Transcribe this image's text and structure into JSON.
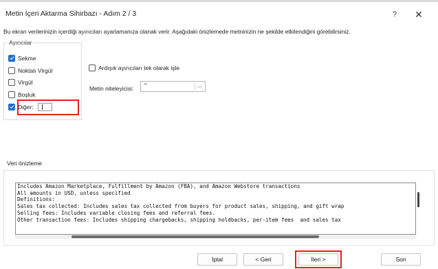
{
  "window": {
    "title": "Metin İçeri Aktarma Sihirbazı - Adım 2 / 3",
    "help_label": "?",
    "close_label": "✕"
  },
  "description": "Bu ekran verilerinizin içerdiği ayırıcıları ayarlamanıza olanak verir. Aşağıdaki önizlemede metninizin ne şekilde etkilendiğini görebilirsiniz.",
  "delimiters": {
    "group_label": "Ayırıcılar",
    "items": [
      {
        "label": "Sekme",
        "checked": true
      },
      {
        "label": "Noktalı Virgül",
        "checked": false
      },
      {
        "label": "Virgül",
        "checked": false
      },
      {
        "label": "Boşluk",
        "checked": false
      },
      {
        "label": "Diğer:",
        "checked": true
      }
    ],
    "other_value": ""
  },
  "options": {
    "consecutive_label": "Ardışık ayırıcıları tek olarak işle",
    "consecutive_checked": false,
    "qualifier_label": "Metin niteleyicisi:",
    "qualifier_value": "\""
  },
  "preview": {
    "label": "Veri önizleme",
    "lines": [
      "Includes Amazon Marketplace, Fulfillment by Amazon (FBA), and Amazon Webstore transactions",
      "All amounts in USD, unless specified",
      "Definitions:",
      "Sales tax collected: Includes sales tax collected from buyers for product sales, shipping, and gift wrap",
      "Selling fees: Includes variable closing fees and referral fees.",
      "Other transaction fees: Includes shipping chargebacks, shipping holdbacks, per-item fees  and sales tax"
    ]
  },
  "buttons": {
    "cancel": "İptal",
    "back": "< Geri",
    "next": "İleri >",
    "finish": "Son"
  },
  "colors": {
    "highlight": "#e0211b",
    "checkbox_checked": "#1f6fd1"
  }
}
